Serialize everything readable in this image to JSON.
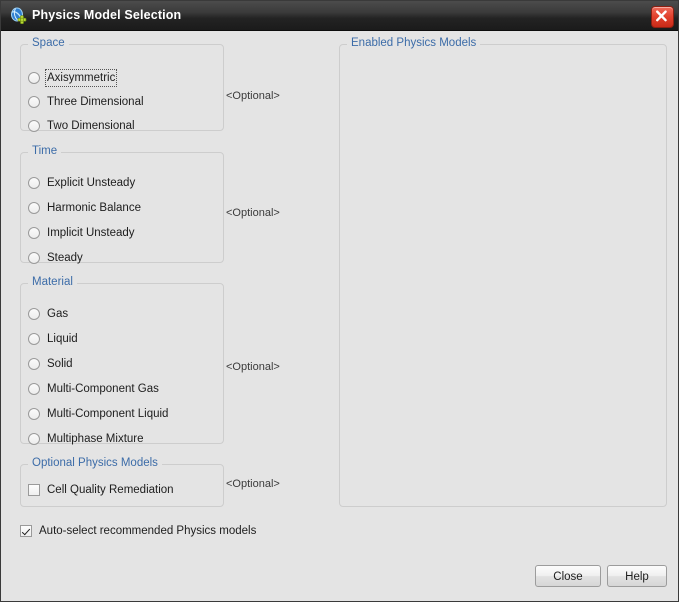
{
  "window": {
    "title": "Physics Model Selection",
    "app_icon": "physics-model-icon",
    "close_icon": "close-icon"
  },
  "optional_tag": "<Optional>",
  "groups": [
    {
      "title": "Space",
      "kind": "radio",
      "options": [
        {
          "label": "Axisymmetric",
          "selected": false,
          "focused": true
        },
        {
          "label": "Three Dimensional",
          "selected": false,
          "focused": false
        },
        {
          "label": "Two Dimensional",
          "selected": false,
          "focused": false
        }
      ]
    },
    {
      "title": "Time",
      "kind": "radio",
      "options": [
        {
          "label": "Explicit Unsteady",
          "selected": false,
          "focused": false
        },
        {
          "label": "Harmonic Balance",
          "selected": false,
          "focused": false
        },
        {
          "label": "Implicit Unsteady",
          "selected": false,
          "focused": false
        },
        {
          "label": "Steady",
          "selected": false,
          "focused": false
        }
      ]
    },
    {
      "title": "Material",
      "kind": "radio",
      "options": [
        {
          "label": "Gas",
          "selected": false,
          "focused": false
        },
        {
          "label": "Liquid",
          "selected": false,
          "focused": false
        },
        {
          "label": "Solid",
          "selected": false,
          "focused": false
        },
        {
          "label": "Multi-Component Gas",
          "selected": false,
          "focused": false
        },
        {
          "label": "Multi-Component Liquid",
          "selected": false,
          "focused": false
        },
        {
          "label": "Multiphase Mixture",
          "selected": false,
          "focused": false
        }
      ]
    },
    {
      "title": "Optional Physics Models",
      "kind": "checkbox",
      "options": [
        {
          "label": "Cell Quality Remediation",
          "checked": false
        }
      ]
    }
  ],
  "auto_select": {
    "label": "Auto-select recommended Physics models",
    "checked": true
  },
  "enabled_panel": {
    "title": "Enabled Physics Models",
    "items": []
  },
  "buttons": {
    "close": "Close",
    "help": "Help"
  },
  "colors": {
    "group_title": "#3c6ca8",
    "dialog_background": "#e4e4e4",
    "titlebar": "#2b2b2b",
    "close_button": "#d8331f"
  }
}
